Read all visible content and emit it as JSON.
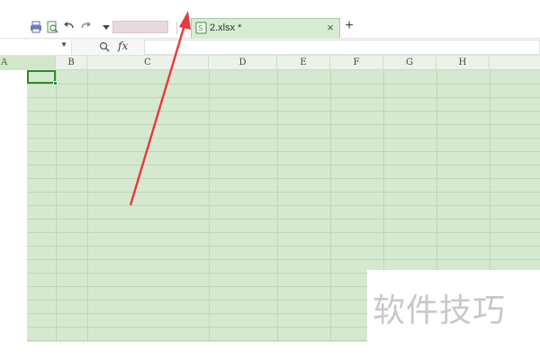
{
  "toolbar": {
    "quick_access_icons": [
      "print-icon",
      "print-preview-icon",
      "undo-icon",
      "redo-icon",
      "customize-dropdown-icon"
    ],
    "document_tab": {
      "icon": "spreadsheet-file-icon",
      "label": "2.xlsx *",
      "close_label": "×"
    },
    "new_tab_label": "+"
  },
  "formula_bar": {
    "name_box_value": "",
    "zoom_icon": "zoom-icon",
    "fx_label": "fx",
    "formula_value": ""
  },
  "sheet": {
    "columns": [
      "A",
      "B",
      "C",
      "D",
      "E",
      "F",
      "G",
      "H"
    ],
    "selected_cell": "A1"
  },
  "colors": {
    "grid_fill": "#d5e9d0",
    "active_cell_border": "#2e8b2e",
    "arrow": "#e83a3a",
    "tab_fill": "#d7ecd2"
  },
  "watermark": "软件技巧"
}
